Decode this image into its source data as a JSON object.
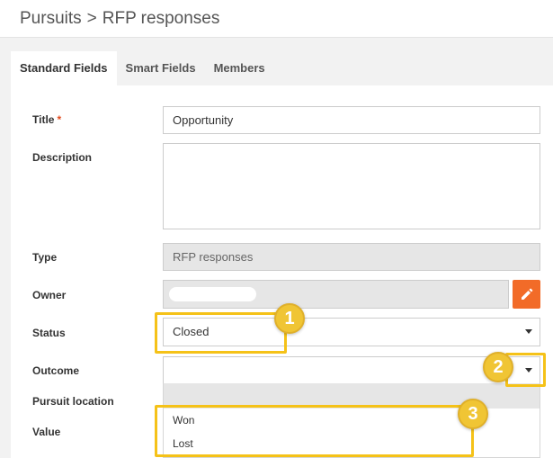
{
  "header": {
    "breadcrumb_parent": "Pursuits",
    "breadcrumb_separator": ">",
    "breadcrumb_current": "RFP responses"
  },
  "tabs": [
    {
      "label": "Standard Fields",
      "active": true
    },
    {
      "label": "Smart Fields",
      "active": false
    },
    {
      "label": "Members",
      "active": false
    }
  ],
  "form": {
    "title": {
      "label": "Title",
      "required_mark": "*",
      "value": "Opportunity"
    },
    "description": {
      "label": "Description",
      "value": ""
    },
    "type": {
      "label": "Type",
      "value": "RFP responses"
    },
    "owner": {
      "label": "Owner",
      "edit_icon": "pencil-icon"
    },
    "status": {
      "label": "Status",
      "value": "Closed"
    },
    "outcome": {
      "label": "Outcome",
      "value": "",
      "options": [
        "Won",
        "Lost"
      ]
    },
    "pursuit_location": {
      "label": "Pursuit location"
    },
    "value": {
      "label": "Value"
    }
  },
  "annotations": {
    "badge_1": "1",
    "badge_2": "2",
    "badge_3": "3",
    "highlight_color": "#f5c218"
  },
  "colors": {
    "accent_orange": "#f26b28",
    "required": "#e24b1e"
  }
}
